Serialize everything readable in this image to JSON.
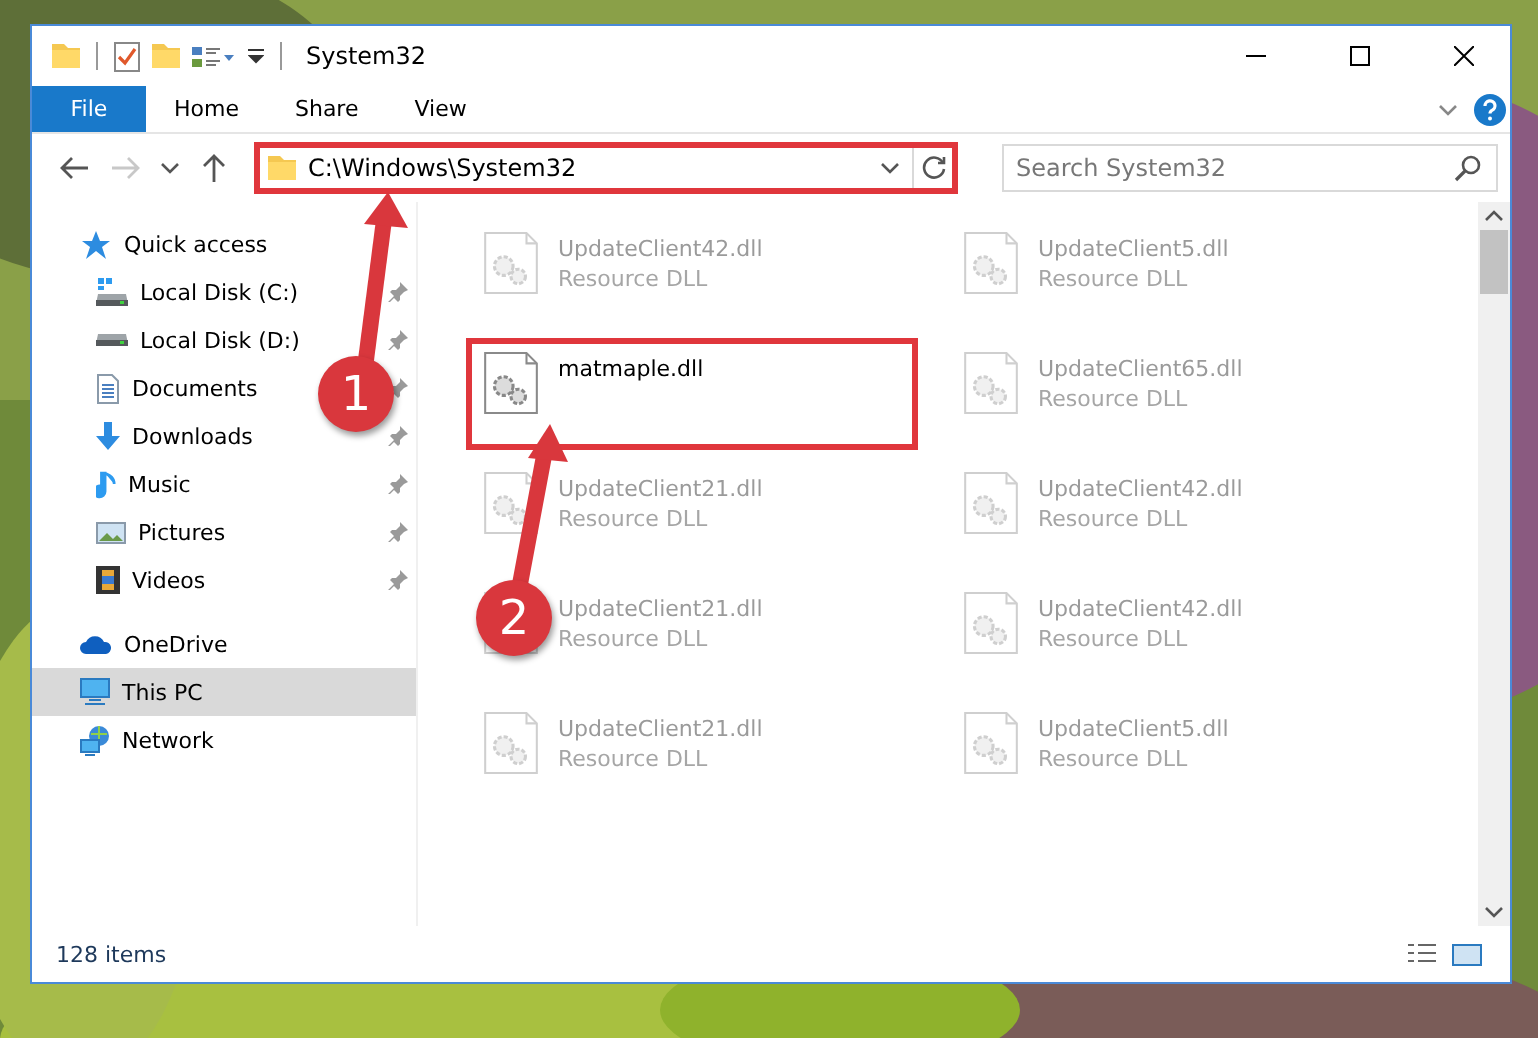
{
  "window": {
    "title": "System32"
  },
  "ribbon_tabs": [
    {
      "label": "File",
      "kind": "menu",
      "selected": false
    },
    {
      "label": "Home",
      "kind": "tab",
      "selected": false
    },
    {
      "label": "Share",
      "kind": "tab",
      "selected": false
    },
    {
      "label": "View",
      "kind": "tab",
      "selected": false
    }
  ],
  "address": {
    "value": "C:\\Windows\\System32",
    "highlighted": true
  },
  "search": {
    "placeholder": "Search System32"
  },
  "sidebar": {
    "items": [
      {
        "label": "Quick access",
        "selected": false,
        "children": [
          {
            "label": "Local Disk (C:)",
            "pinned": true,
            "selected": false
          },
          {
            "label": "Local Disk (D:)",
            "pinned": true,
            "selected": false
          },
          {
            "label": "Documents",
            "pinned": true,
            "selected": false
          },
          {
            "label": "Downloads",
            "pinned": true,
            "selected": false
          },
          {
            "label": "Music",
            "pinned": true,
            "selected": false
          },
          {
            "label": "Pictures",
            "pinned": true,
            "selected": false
          },
          {
            "label": "Videos",
            "pinned": true,
            "selected": false
          }
        ]
      },
      {
        "label": "OneDrive",
        "selected": false
      },
      {
        "label": "This PC",
        "selected": true
      },
      {
        "label": "Network",
        "selected": false
      }
    ]
  },
  "files": [
    {
      "name": "UpdateClient42.dll",
      "type": "Resource DLL",
      "blurred": true,
      "highlighted": false
    },
    {
      "name": "UpdateClient5.dll",
      "type": "Resource DLL",
      "blurred": true,
      "highlighted": false
    },
    {
      "name": "matmaple.dll",
      "blurred": false,
      "highlighted": true
    },
    {
      "name": "UpdateClient65.dll",
      "type": "Resource DLL",
      "blurred": true,
      "highlighted": false
    },
    {
      "name": "UpdateClient21.dll",
      "type": "Resource DLL",
      "blurred": true,
      "highlighted": false
    },
    {
      "name": "UpdateClient42.dll",
      "type": "Resource DLL",
      "blurred": true,
      "highlighted": false
    },
    {
      "name": "UpdateClient21.dll",
      "type": "Resource DLL",
      "blurred": true,
      "highlighted": false
    },
    {
      "name": "UpdateClient42.dll",
      "type": "Resource DLL",
      "blurred": true,
      "highlighted": false
    },
    {
      "name": "UpdateClient21.dll",
      "type": "Resource DLL",
      "blurred": true,
      "highlighted": false
    },
    {
      "name": "UpdateClient5.dll",
      "type": "Resource DLL",
      "blurred": true,
      "highlighted": false
    }
  ],
  "callouts": [
    {
      "number": "1"
    },
    {
      "number": "2"
    }
  ],
  "status_bar": {
    "text": "128 items"
  }
}
